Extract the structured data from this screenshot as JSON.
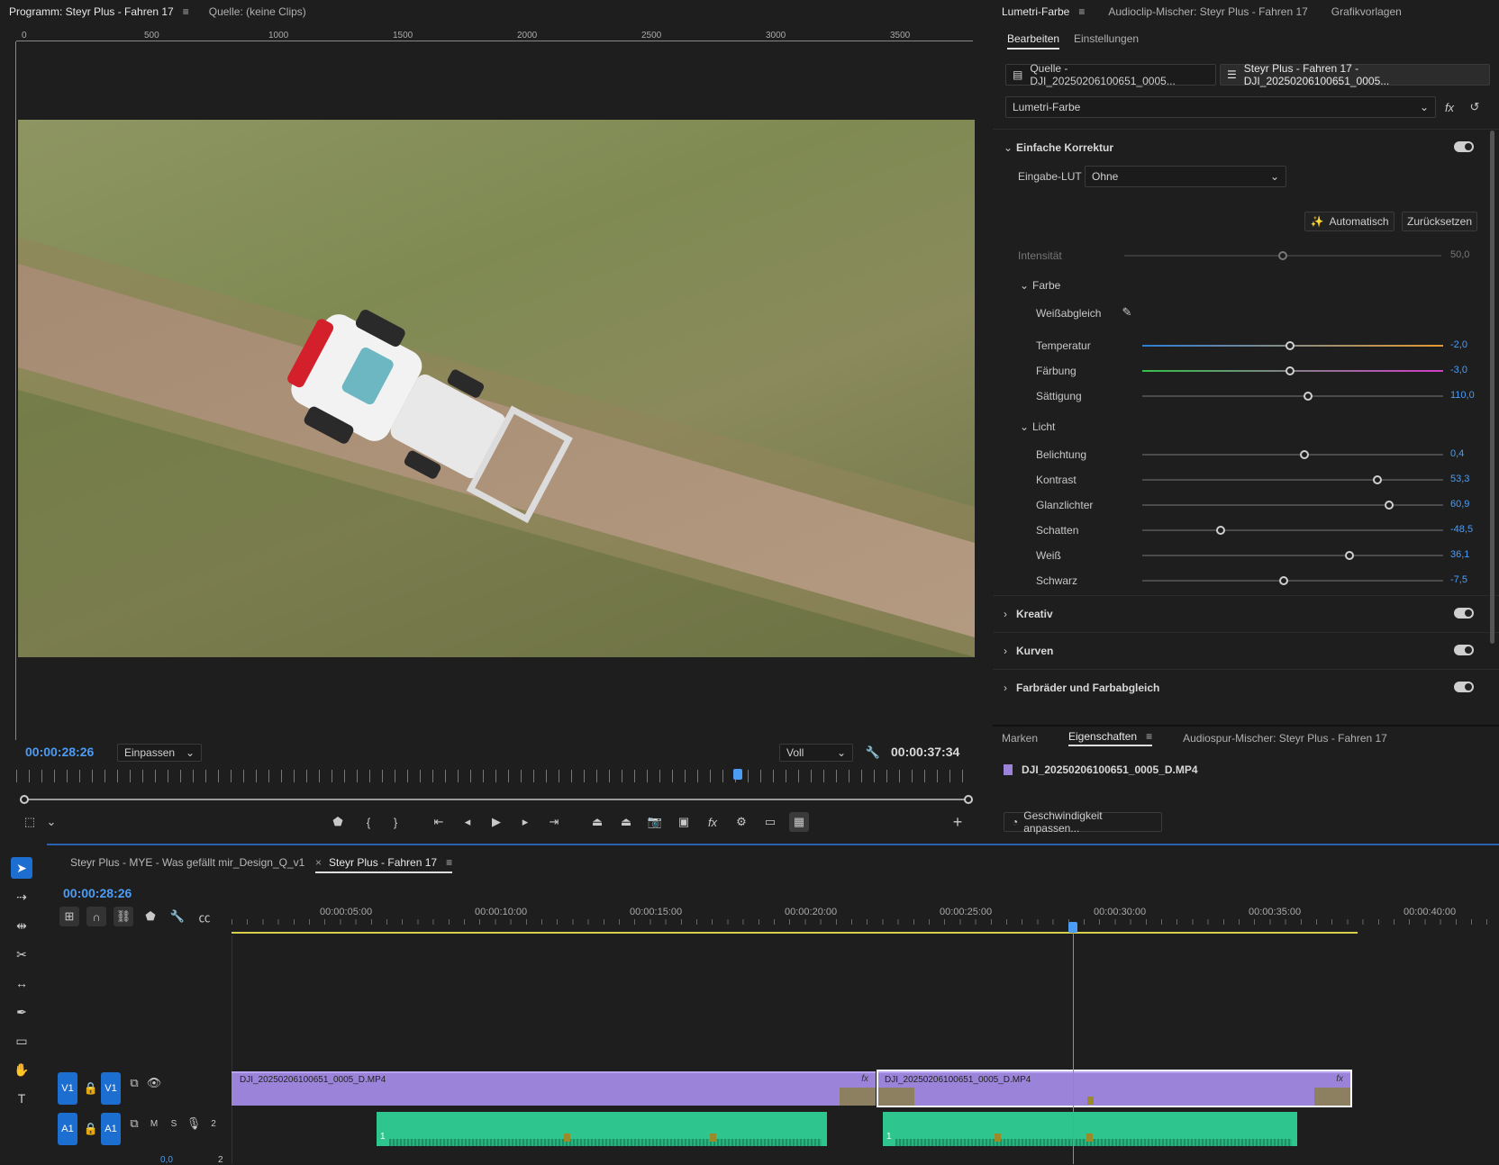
{
  "program_monitor": {
    "tab_program": "Programm: Steyr Plus - Fahren 17",
    "tab_source": "Quelle: (keine Clips)",
    "ruler": [
      "0",
      "500",
      "1000",
      "1500",
      "2000",
      "2500",
      "3000",
      "3500"
    ],
    "timecode_current": "00:00:28:26",
    "zoom_select": "Einpassen",
    "quality_select": "Voll",
    "timecode_duration": "00:00:37:34"
  },
  "lumetri": {
    "tabs": [
      "Lumetri-Farbe",
      "Audioclip-Mischer: Steyr Plus - Fahren 17",
      "Grafikvorlagen"
    ],
    "subtabs": [
      "Bearbeiten",
      "Einstellungen"
    ],
    "source_tab": "Quelle - DJI_20250206100651_0005...",
    "sequence_tab": "Steyr Plus - Fahren 17 - DJI_20250206100651_0005...",
    "effect_select": "Lumetri-Farbe",
    "fx_label": "fx",
    "section_basic": "Einfache Korrektur",
    "input_lut_label": "Eingabe-LUT",
    "input_lut_value": "Ohne",
    "auto_button": "Automatisch",
    "reset_button": "Zurücksetzen",
    "intensity": {
      "label": "Intensität",
      "value": "50,0",
      "fraction": 0.5
    },
    "color_group": "Farbe",
    "white_balance": "Weißabgleich",
    "color_sliders": [
      {
        "label": "Temperatur",
        "value": "-2,0",
        "fraction": 0.49
      },
      {
        "label": "Färbung",
        "value": "-3,0",
        "fraction": 0.49
      },
      {
        "label": "Sättigung",
        "value": "110,0",
        "fraction": 0.55
      }
    ],
    "light_group": "Licht",
    "light_sliders": [
      {
        "label": "Belichtung",
        "value": "0,4",
        "fraction": 0.54
      },
      {
        "label": "Kontrast",
        "value": "53,3",
        "fraction": 0.78
      },
      {
        "label": "Glanzlichter",
        "value": "60,9",
        "fraction": 0.82
      },
      {
        "label": "Schatten",
        "value": "-48,5",
        "fraction": 0.26
      },
      {
        "label": "Weiß",
        "value": "36,1",
        "fraction": 0.69
      },
      {
        "label": "Schwarz",
        "value": "-7,5",
        "fraction": 0.47
      }
    ],
    "sections": [
      "Kreativ",
      "Kurven",
      "Farbräder und Farbabgleich"
    ]
  },
  "properties": {
    "tabs": [
      "Marken",
      "Eigenschaften",
      "Audiospur-Mischer: Steyr Plus - Fahren 17"
    ],
    "clip_name": "DJI_20250206100651_0005_D.MP4",
    "speed_button": "Geschwindigkeit anpassen..."
  },
  "timeline": {
    "tab_inactive": "Steyr Plus - MYE - Was gefällt mir_Design_Q_v1",
    "tab_active": "Steyr Plus - Fahren 17",
    "timecode": "00:00:28:26",
    "ruler": [
      "00:00:05:00",
      "00:00:10:00",
      "00:00:15:00",
      "00:00:20:00",
      "00:00:25:00",
      "00:00:30:00",
      "00:00:35:00",
      "00:00:40:00"
    ],
    "video_track": "V1",
    "audio_track": "A1",
    "clip1": "DJI_20250206100651_0005_D.MP4",
    "clip2": "DJI_20250206100651_0005_D.MP4",
    "audio_m": "M",
    "audio_s": "S",
    "audio_num": "2",
    "audio_marker": "1",
    "master_value": "0,0",
    "master_num": "2"
  },
  "colors": {
    "accent": "#4b9cf5",
    "video_clip": "#9a83d8",
    "audio_clip": "#2fc58e"
  }
}
